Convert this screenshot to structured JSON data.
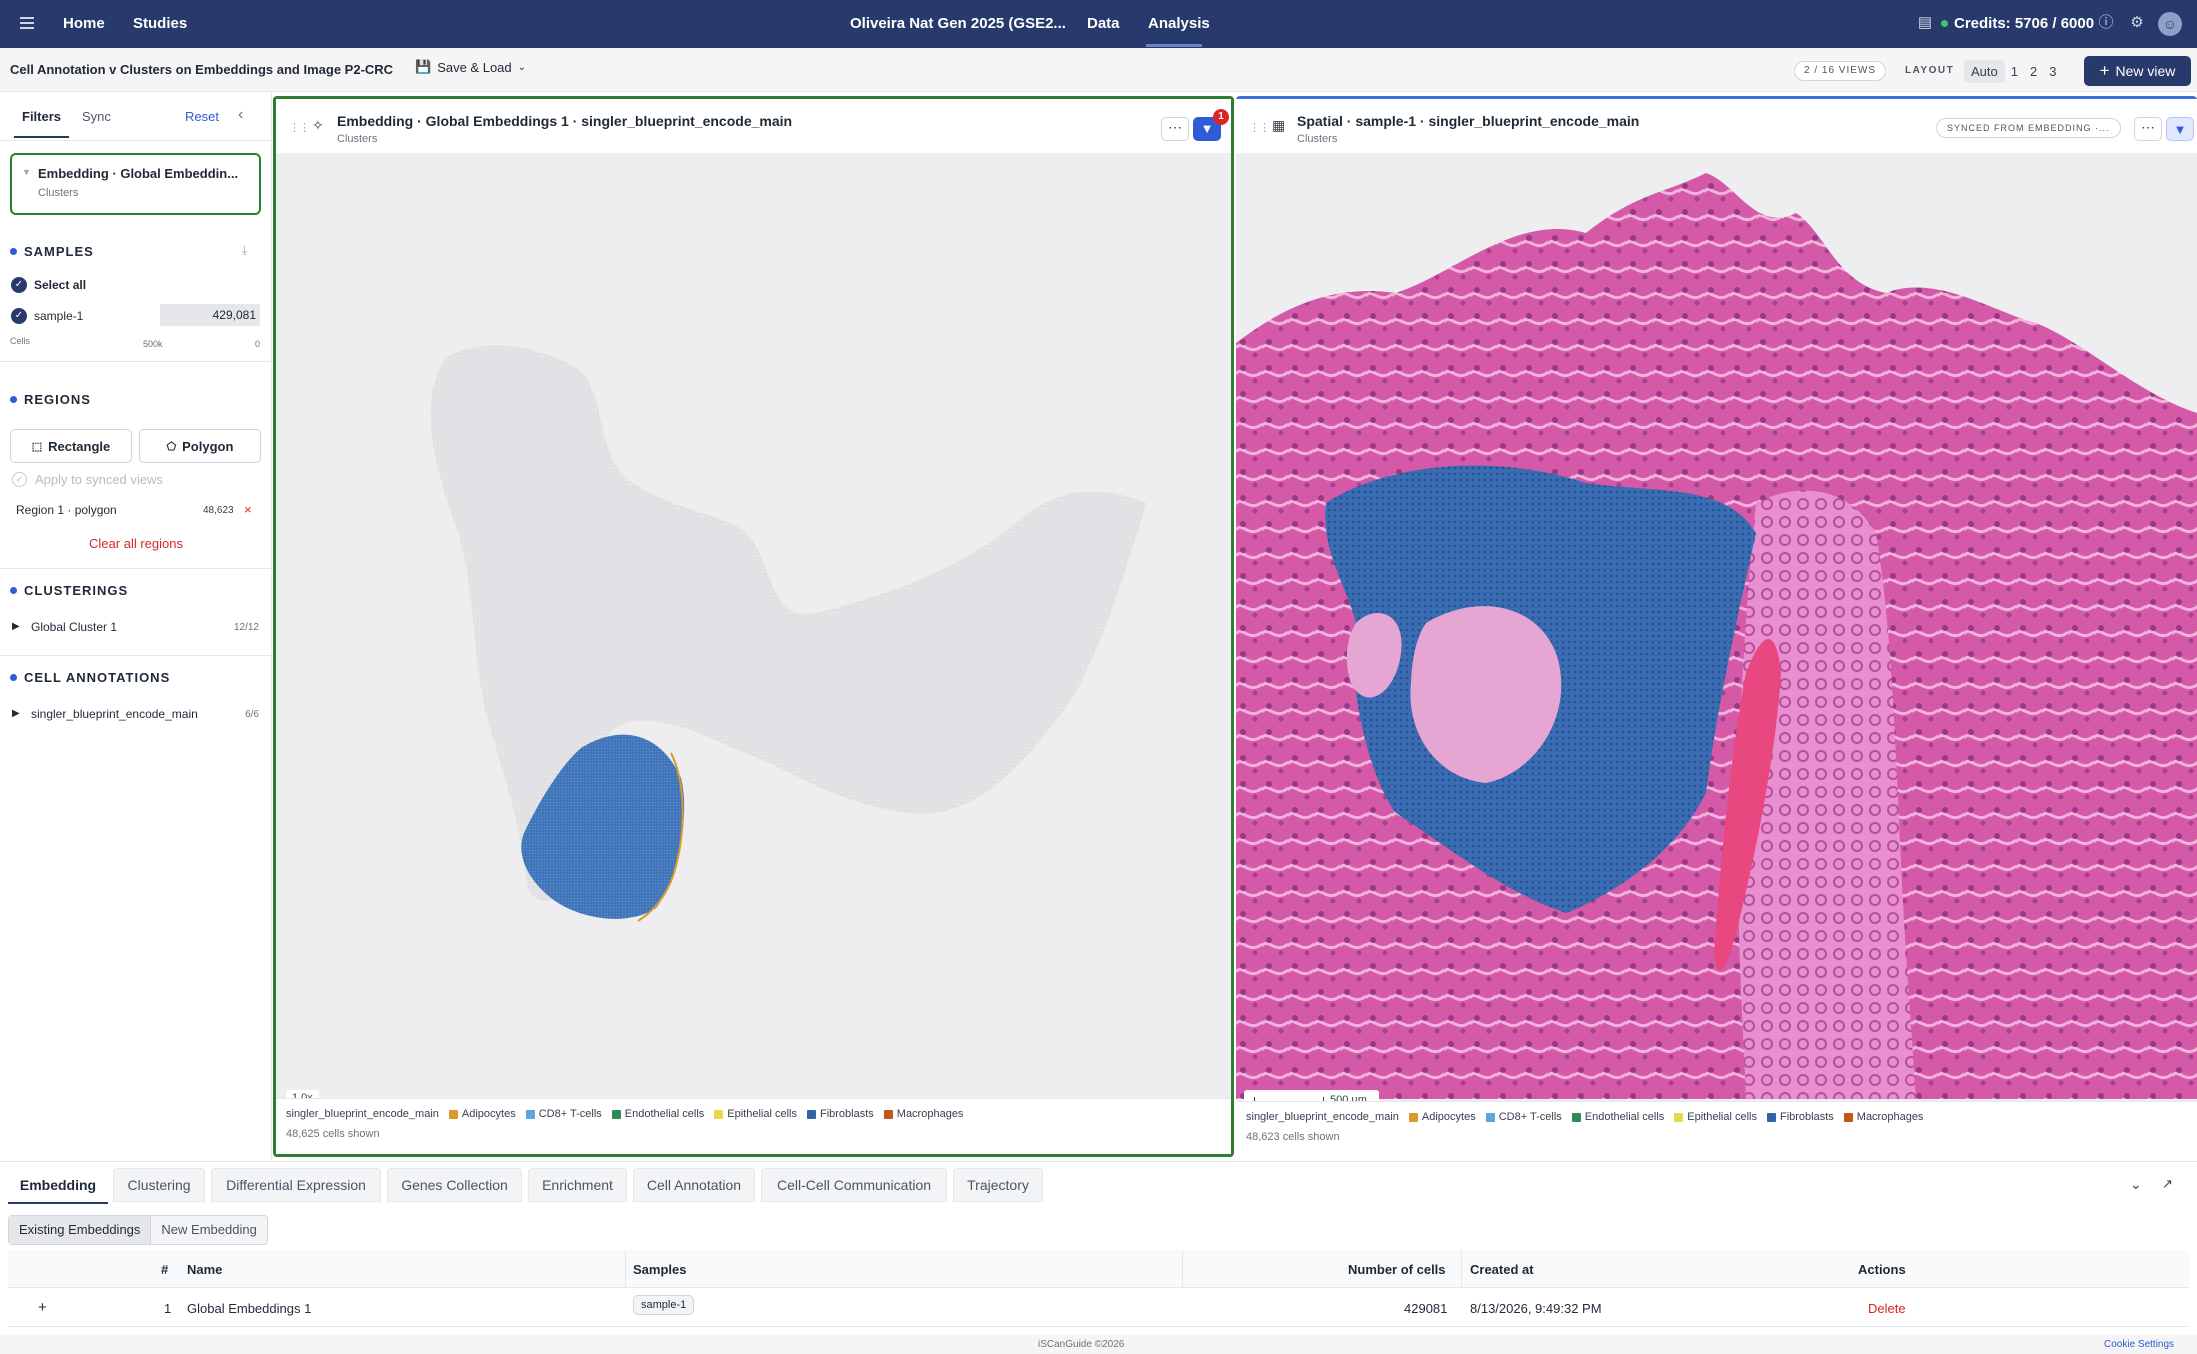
{
  "nav": {
    "home": "Home",
    "studies": "Studies",
    "study_name": "Oliveira Nat Gen 2025 (GSE2...",
    "data": "Data",
    "analysis": "Analysis",
    "credits": "Credits: 5706 / 6000"
  },
  "toolbar": {
    "title": "Cell Annotation v Clusters on Embeddings and Image P2-CRC",
    "save_load": "Save & Load",
    "views": "2 / 16 VIEWS",
    "layout_label": "LAYOUT",
    "layout_options": [
      "Auto",
      "1",
      "2",
      "3"
    ],
    "new_view": "New view"
  },
  "sidebar": {
    "tab_filters": "Filters",
    "tab_sync": "Sync",
    "reset": "Reset",
    "active_view_title": "Embedding · Global Embeddin...",
    "active_view_sub": "Clusters",
    "samples": {
      "title": "SAMPLES",
      "select_all": "Select all",
      "sample_name": "sample-1",
      "sample_count": "429,081",
      "axis_label": "Cells",
      "axis_max": "500k",
      "axis_min": "0"
    },
    "regions": {
      "title": "REGIONS",
      "rectangle": "Rectangle",
      "polygon": "Polygon",
      "apply_synced": "Apply to synced views",
      "region_name": "Region 1 · polygon",
      "region_count": "48,623",
      "clear_all": "Clear all regions"
    },
    "clusterings": {
      "title": "CLUSTERINGS",
      "item": "Global Cluster 1",
      "count": "12/12"
    },
    "annotations": {
      "title": "CELL ANNOTATIONS",
      "item": "singler_blueprint_encode_main",
      "count": "6/6"
    }
  },
  "panels": {
    "embedding": {
      "title": "Embedding · Global Embeddings 1 · singler_blueprint_encode_main",
      "subtitle": "Clusters",
      "filter_badge": "1",
      "zoom": "1.0x",
      "cells_shown": "48,625 cells shown"
    },
    "spatial": {
      "title": "Spatial · sample-1 · singler_blueprint_encode_main",
      "subtitle": "Clusters",
      "synced": "SYNCED FROM EMBEDDING ·...",
      "scale": "500 µm",
      "cells_shown": "48,623 cells shown"
    },
    "legend_title": "singler_blueprint_encode_main",
    "legend": [
      {
        "label": "Adipocytes",
        "color": "#d89a2b"
      },
      {
        "label": "CD8+ T-cells",
        "color": "#5aa6e0"
      },
      {
        "label": "Endothelial cells",
        "color": "#2e8b57"
      },
      {
        "label": "Epithelial cells",
        "color": "#e6d84a"
      },
      {
        "label": "Fibroblasts",
        "color": "#2f64a8"
      },
      {
        "label": "Macrophages",
        "color": "#c2571a"
      }
    ]
  },
  "bottom": {
    "tabs": [
      "Embedding",
      "Clustering",
      "Differential Expression",
      "Genes Collection",
      "Enrichment",
      "Cell Annotation",
      "Cell-Cell Communication",
      "Trajectory"
    ],
    "subtabs": [
      "Existing Embeddings",
      "New Embedding"
    ],
    "columns": [
      "#",
      "Name",
      "Samples",
      "Number of cells",
      "Created at",
      "Actions"
    ],
    "row": {
      "expand": "+",
      "index": "1",
      "name": "Global Embeddings 1",
      "sample": "sample-1",
      "cells": "429081",
      "created": "8/13/2026, 9:49:32 PM",
      "action": "Delete"
    }
  },
  "footer": {
    "brand": "iSCanGuide ©2026",
    "cookie": "Cookie Settings"
  }
}
